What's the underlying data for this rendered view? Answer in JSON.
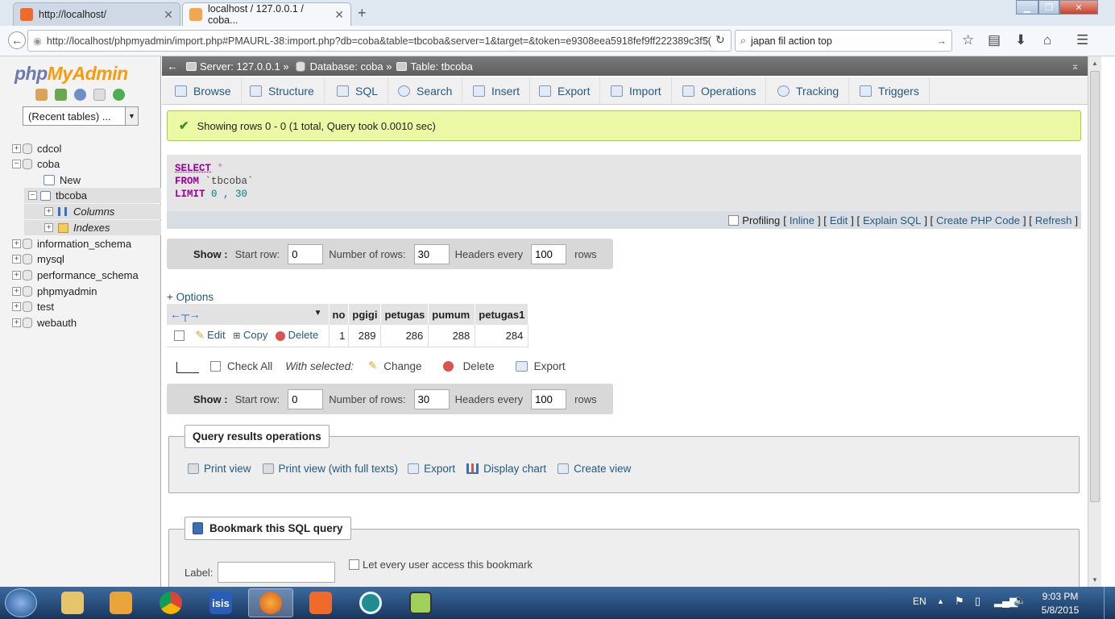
{
  "browser": {
    "tabs": [
      {
        "title": "http://localhost/"
      },
      {
        "title": "localhost / 127.0.0.1 / coba..."
      }
    ],
    "url": "http://localhost/phpmyadmin/import.php#PMAURL-38:import.php?db=coba&table=tbcoba&server=1&target=&token=e9308eea5918fef9ff222389c3f5(",
    "search": "japan fil action top"
  },
  "sidebar": {
    "logo_a": "php",
    "logo_b": "MyAdmin",
    "recent": "(Recent tables) ...",
    "items": [
      {
        "label": "cdcol"
      },
      {
        "label": "coba"
      },
      {
        "label": "New"
      },
      {
        "label": "tbcoba"
      },
      {
        "label": "Columns"
      },
      {
        "label": "Indexes"
      },
      {
        "label": "information_schema"
      },
      {
        "label": "mysql"
      },
      {
        "label": "performance_schema"
      },
      {
        "label": "phpmyadmin"
      },
      {
        "label": "test"
      },
      {
        "label": "webauth"
      }
    ]
  },
  "breadcrumb": {
    "server": "Server: 127.0.0.1 »",
    "database": "Database: coba »",
    "table": "Table: tbcoba"
  },
  "tabs": [
    "Browse",
    "Structure",
    "SQL",
    "Search",
    "Insert",
    "Export",
    "Import",
    "Operations",
    "Tracking",
    "Triggers"
  ],
  "message": "Showing rows 0 - 0 (1 total, Query took 0.0010 sec)",
  "sql": {
    "select": "SELECT",
    "star": " *",
    "from": "FROM",
    "table": " `tbcoba`",
    "limit": "LIMIT",
    "limit_vals": " 0 , 30"
  },
  "sql_links": {
    "profiling": "Profiling",
    "inline": "Inline",
    "edit": "Edit",
    "explain": "Explain SQL",
    "php": "Create PHP Code",
    "refresh": "Refresh"
  },
  "nav": {
    "show": "Show :",
    "start_label": "Start row:",
    "start_value": "0",
    "rows_label": "Number of rows:",
    "rows_value": "30",
    "headers_label": "Headers every",
    "headers_value": "100",
    "rows_suffix": "rows"
  },
  "options": "+ Options",
  "table": {
    "columns": [
      "no",
      "pgigi",
      "petugas",
      "pumum",
      "petugas1"
    ],
    "rows": [
      {
        "edit": "Edit",
        "copy": "Copy",
        "delete": "Delete",
        "values": [
          "1",
          "289",
          "286",
          "288",
          "284"
        ]
      }
    ]
  },
  "bulk": {
    "check_all": "Check All",
    "with_selected": "With selected:",
    "change": "Change",
    "delete": "Delete",
    "export": "Export"
  },
  "query_ops": {
    "legend": "Query results operations",
    "print": "Print view",
    "print_full": "Print view (with full texts)",
    "export": "Export",
    "chart": "Display chart",
    "view": "Create view"
  },
  "bookmark": {
    "legend": "Bookmark this SQL query",
    "label": "Label:",
    "every_user": "Let every user access this bookmark"
  },
  "taskbar": {
    "lang": "EN",
    "time": "9:03 PM",
    "date": "5/8/2015"
  }
}
